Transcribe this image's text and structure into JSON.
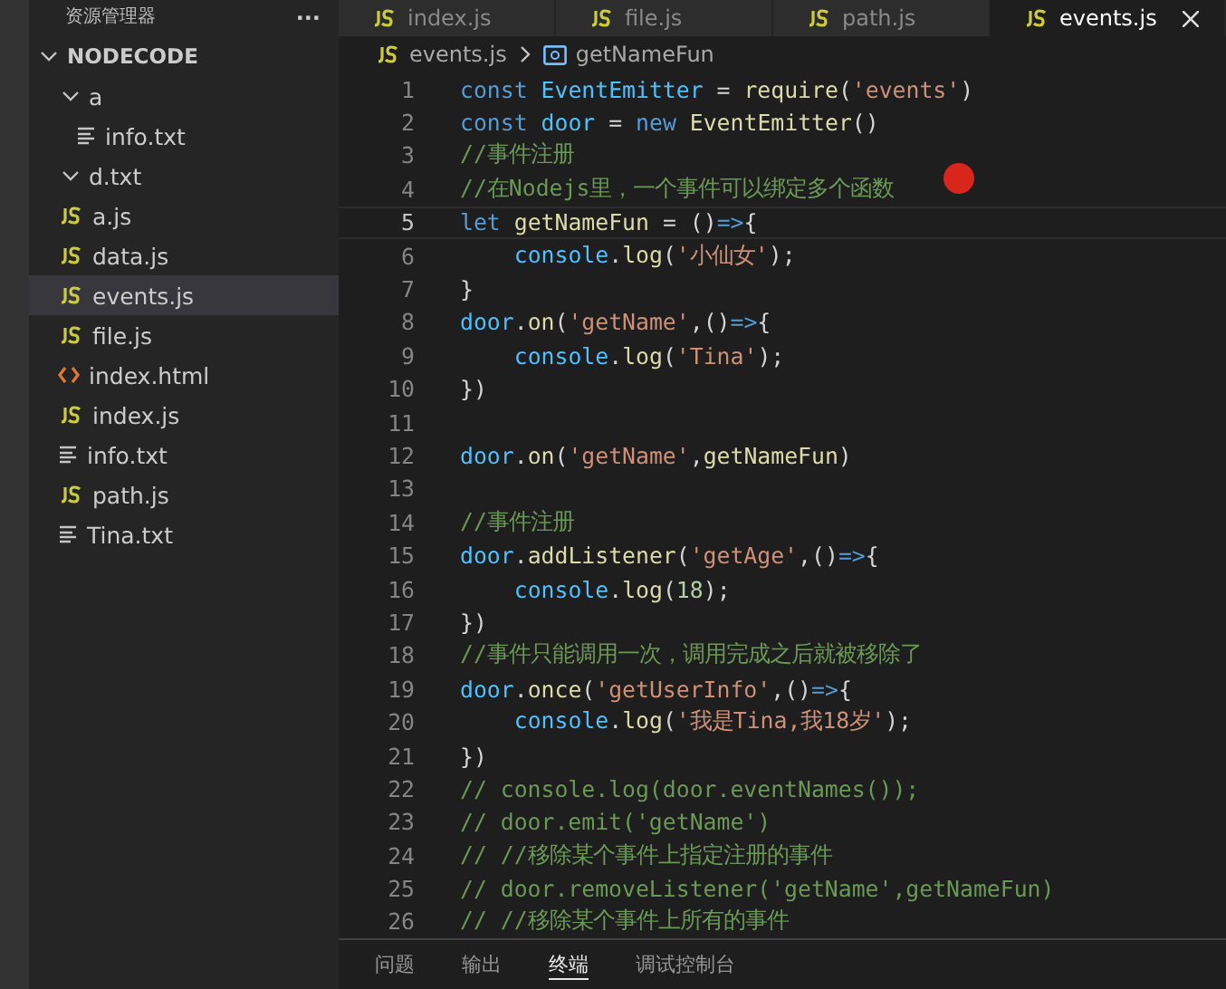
{
  "sidebar": {
    "title": "资源管理器",
    "more": "···",
    "root": {
      "label": "NODECODE",
      "expanded": true,
      "children": [
        {
          "label": "a",
          "kind": "folder",
          "expanded": true,
          "selected": false,
          "children": [
            {
              "label": "info.txt",
              "kind": "txt",
              "selected": false
            }
          ]
        },
        {
          "label": "d.txt",
          "kind": "folder",
          "expanded": true,
          "selected": false
        },
        {
          "label": "a.js",
          "kind": "js",
          "selected": false
        },
        {
          "label": "data.js",
          "kind": "js",
          "selected": false
        },
        {
          "label": "events.js",
          "kind": "js",
          "selected": true
        },
        {
          "label": "file.js",
          "kind": "js",
          "selected": false
        },
        {
          "label": "index.html",
          "kind": "html",
          "selected": false
        },
        {
          "label": "index.js",
          "kind": "js",
          "selected": false
        },
        {
          "label": "info.txt",
          "kind": "txt",
          "selected": false
        },
        {
          "label": "path.js",
          "kind": "js",
          "selected": false
        },
        {
          "label": "Tina.txt",
          "kind": "txt",
          "selected": false
        }
      ]
    }
  },
  "tabs": [
    {
      "label": "index.js",
      "selected": false
    },
    {
      "label": "file.js",
      "selected": false
    },
    {
      "label": "path.js",
      "selected": false
    },
    {
      "label": "events.js",
      "selected": true
    }
  ],
  "breadcrumb": {
    "file": "events.js",
    "symbol": "getNameFun"
  },
  "code": [
    {
      "n": "1",
      "current": false,
      "text": "const EventEmitter = require('events')"
    },
    {
      "n": "2",
      "current": false,
      "text": "const door = new EventEmitter()"
    },
    {
      "n": "3",
      "current": false,
      "text": "//事件注册"
    },
    {
      "n": "4",
      "current": false,
      "text": "//在Nodejs里，一个事件可以绑定多个函数"
    },
    {
      "n": "5",
      "current": true,
      "text": "let getNameFun = ()=>{"
    },
    {
      "n": "6",
      "current": false,
      "text": "    console.log('小仙女');"
    },
    {
      "n": "7",
      "current": false,
      "text": "}"
    },
    {
      "n": "8",
      "current": false,
      "text": "door.on('getName',()=>{"
    },
    {
      "n": "9",
      "current": false,
      "text": "    console.log('Tina');"
    },
    {
      "n": "10",
      "current": false,
      "text": "})"
    },
    {
      "n": "11",
      "current": false
    },
    {
      "n": "12",
      "current": false,
      "text": "door.on('getName',getNameFun)"
    },
    {
      "n": "13",
      "current": false
    },
    {
      "n": "14",
      "current": false,
      "text": "//事件注册"
    },
    {
      "n": "15",
      "current": false,
      "text": "door.addListener('getAge',()=>{"
    },
    {
      "n": "16",
      "current": false,
      "text": "    console.log(18);"
    },
    {
      "n": "17",
      "current": false,
      "text": "})"
    },
    {
      "n": "18",
      "current": false,
      "text": "//事件只能调用一次，调用完成之后就被移除了"
    },
    {
      "n": "19",
      "current": false,
      "text": "door.once('getUserInfo',()=>{"
    },
    {
      "n": "20",
      "current": false,
      "text": "    console.log('我是Tina,我18岁');"
    },
    {
      "n": "21",
      "current": false,
      "text": "})"
    },
    {
      "n": "22",
      "current": false,
      "text": "// console.log(door.eventNames());"
    },
    {
      "n": "23",
      "current": false,
      "text": "// door.emit('getName')"
    },
    {
      "n": "24",
      "current": false,
      "text": "// //移除某个事件上指定注册的事件"
    },
    {
      "n": "25",
      "current": false,
      "text": "// door.removeListener('getName',getNameFun)"
    },
    {
      "n": "26",
      "current": false,
      "text": "// //移除某个事件上所有的事件"
    }
  ],
  "panel_tabs": [
    {
      "label": "问题",
      "selected": false
    },
    {
      "label": "输出",
      "selected": false
    },
    {
      "label": "终端",
      "selected": true
    },
    {
      "label": "调试控制台",
      "selected": false
    }
  ]
}
